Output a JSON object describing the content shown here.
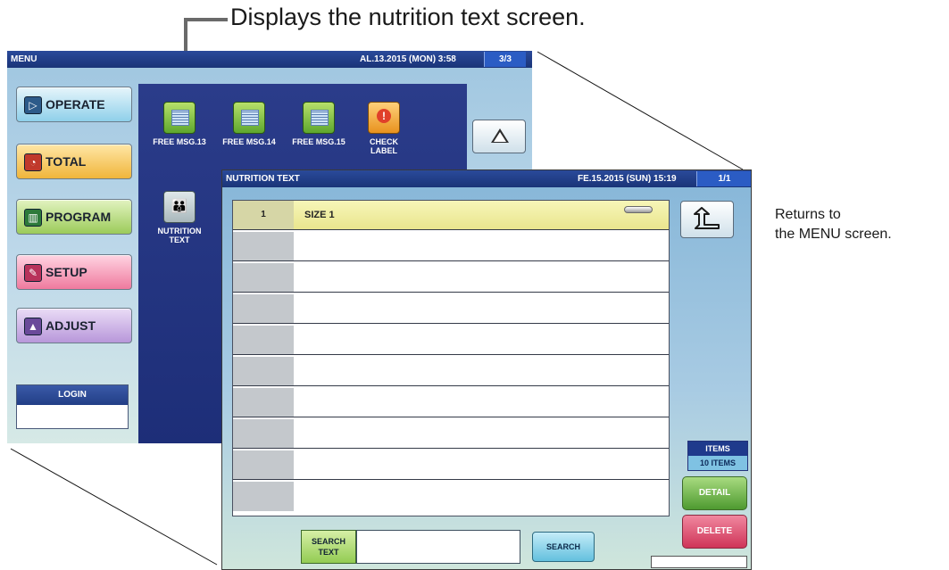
{
  "callouts": {
    "top": "Displays the nutrition text screen.",
    "right_line1": "Returns to",
    "right_line2": "the MENU screen."
  },
  "menu_screen": {
    "title": "MENU",
    "date": "AL.13.2015 (MON)  3:58",
    "page": "3/3",
    "buttons": [
      {
        "label": "OPERATE",
        "icon": "operate-icon"
      },
      {
        "label": "TOTAL",
        "icon": "total-icon"
      },
      {
        "label": "PROGRAM",
        "icon": "program-icon"
      },
      {
        "label": "SETUP",
        "icon": "setup-icon"
      },
      {
        "label": "ADJUST",
        "icon": "adjust-icon"
      }
    ],
    "login_label": "LOGIN",
    "apps": [
      {
        "label": "FREE MSG.13",
        "icon": "free-msg-icon"
      },
      {
        "label": "FREE MSG.14",
        "icon": "free-msg-icon"
      },
      {
        "label": "FREE MSG.15",
        "icon": "free-msg-icon"
      },
      {
        "label": "CHECK LABEL",
        "icon": "check-label-icon"
      },
      {
        "label": "NUTRITION TEXT",
        "icon": "nutrition-text-icon"
      }
    ]
  },
  "nutrition_screen": {
    "title": "NUTRITION TEXT",
    "date": "FE.15.2015 (SUN)  15:19",
    "page": "1/1",
    "rows": [
      {
        "num": "1",
        "text": "SIZE 1"
      },
      {
        "num": "",
        "text": ""
      },
      {
        "num": "",
        "text": ""
      },
      {
        "num": "",
        "text": ""
      },
      {
        "num": "",
        "text": ""
      },
      {
        "num": "",
        "text": ""
      },
      {
        "num": "",
        "text": ""
      },
      {
        "num": "",
        "text": ""
      },
      {
        "num": "",
        "text": ""
      },
      {
        "num": "",
        "text": ""
      }
    ],
    "items_label": "ITEMS",
    "items_count": "10 ITEMS",
    "detail_label": "DETAIL",
    "delete_label": "DELETE",
    "search_text_label": "SEARCH TEXT",
    "search_input_value": "",
    "search_button_label": "SEARCH"
  },
  "colors": {
    "titlebar": "#1f3a8c",
    "selected_row": "#eeeaa0",
    "detail": "#5aa83a",
    "delete": "#d8486a"
  }
}
